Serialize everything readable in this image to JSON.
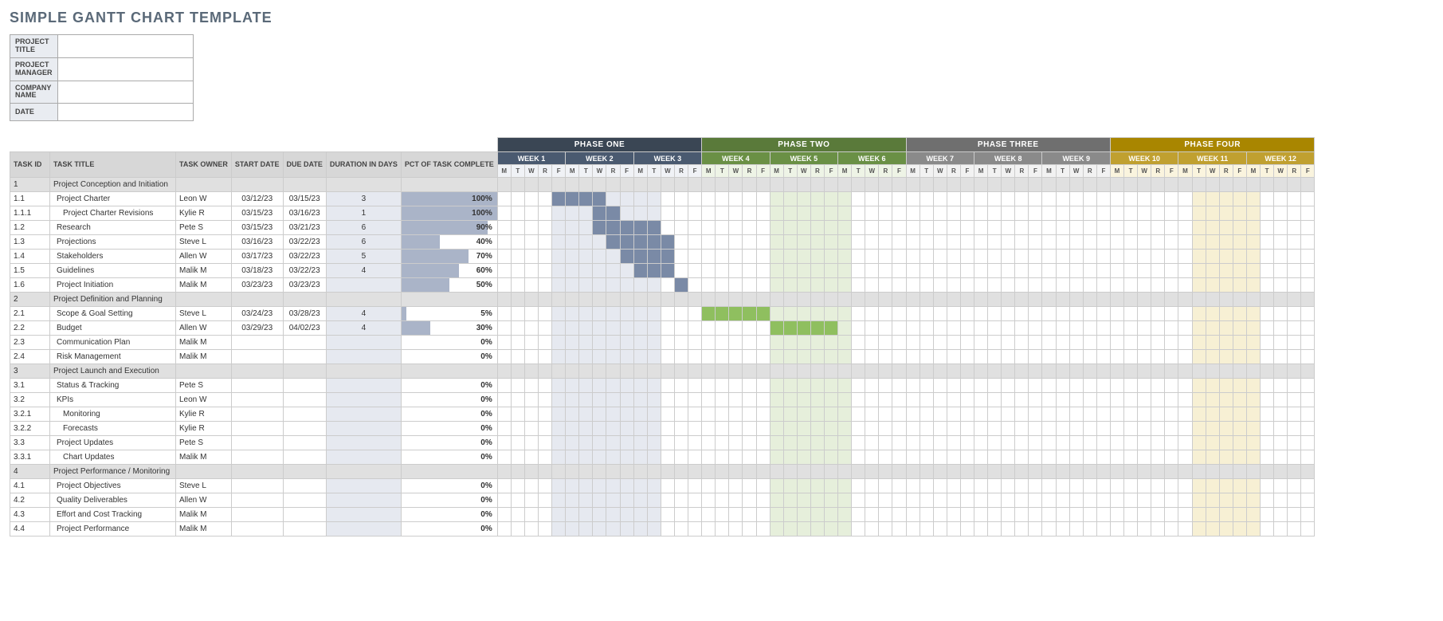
{
  "title": "SIMPLE GANTT CHART TEMPLATE",
  "meta": {
    "project_title_label": "PROJECT TITLE",
    "project_title_value": "",
    "project_manager_label": "PROJECT MANAGER",
    "project_manager_value": "",
    "company_name_label": "COMPANY NAME",
    "company_name_value": "",
    "date_label": "DATE",
    "date_value": ""
  },
  "headers": {
    "task_id": "TASK ID",
    "task_title": "TASK TITLE",
    "task_owner": "TASK OWNER",
    "start_date": "START DATE",
    "due_date": "DUE DATE",
    "duration": "DURATION IN DAYS",
    "pct": "PCT OF TASK COMPLETE"
  },
  "phases": [
    "PHASE ONE",
    "PHASE TWO",
    "PHASE THREE",
    "PHASE FOUR"
  ],
  "weeks": [
    "WEEK 1",
    "WEEK 2",
    "WEEK 3",
    "WEEK 4",
    "WEEK 5",
    "WEEK 6",
    "WEEK 7",
    "WEEK 8",
    "WEEK 9",
    "WEEK 10",
    "WEEK 11",
    "WEEK 12"
  ],
  "days": [
    "M",
    "T",
    "W",
    "R",
    "F"
  ],
  "chart_data": {
    "type": "gantt",
    "shaded_block1": {
      "start": 4,
      "end": 11
    },
    "shaded_block2": {
      "start": 20,
      "end": 25
    },
    "shaded_block4": {
      "start": 51,
      "end": 55
    },
    "rows": [
      {
        "type": "group",
        "id": "1",
        "title": "Project Conception and Initiation"
      },
      {
        "type": "task",
        "id": "1.1",
        "title": "Project Charter",
        "owner": "Leon W",
        "start": "03/12/23",
        "due": "03/15/23",
        "dur": "3",
        "pct": 100,
        "bar": {
          "start": 4,
          "end": 7,
          "color": "p1"
        }
      },
      {
        "type": "task",
        "id": "1.1.1",
        "title": "Project Charter Revisions",
        "owner": "Kylie R",
        "start": "03/15/23",
        "due": "03/16/23",
        "dur": "1",
        "pct": 100,
        "indent": 1,
        "bar": {
          "start": 7,
          "end": 8,
          "color": "p1"
        }
      },
      {
        "type": "task",
        "id": "1.2",
        "title": "Research",
        "owner": "Pete S",
        "start": "03/15/23",
        "due": "03/21/23",
        "dur": "6",
        "pct": 90,
        "bar": {
          "start": 7,
          "end": 11,
          "color": "p1"
        }
      },
      {
        "type": "task",
        "id": "1.3",
        "title": "Projections",
        "owner": "Steve L",
        "start": "03/16/23",
        "due": "03/22/23",
        "dur": "6",
        "pct": 40,
        "bar": {
          "start": 8,
          "end": 12,
          "color": "p1"
        }
      },
      {
        "type": "task",
        "id": "1.4",
        "title": "Stakeholders",
        "owner": "Allen W",
        "start": "03/17/23",
        "due": "03/22/23",
        "dur": "5",
        "pct": 70,
        "bar": {
          "start": 9,
          "end": 12,
          "color": "p1"
        }
      },
      {
        "type": "task",
        "id": "1.5",
        "title": "Guidelines",
        "owner": "Malik M",
        "start": "03/18/23",
        "due": "03/22/23",
        "dur": "4",
        "pct": 60,
        "bar": {
          "start": 10,
          "end": 12,
          "color": "p1"
        }
      },
      {
        "type": "task",
        "id": "1.6",
        "title": "Project Initiation",
        "owner": "Malik M",
        "start": "03/23/23",
        "due": "03/23/23",
        "dur": "",
        "pct": 50,
        "bar": {
          "start": 13,
          "end": 13,
          "color": "p1"
        }
      },
      {
        "type": "group",
        "id": "2",
        "title": "Project Definition and Planning"
      },
      {
        "type": "task",
        "id": "2.1",
        "title": "Scope & Goal Setting",
        "owner": "Steve L",
        "start": "03/24/23",
        "due": "03/28/23",
        "dur": "4",
        "pct": 5,
        "bar": {
          "start": 15,
          "end": 19,
          "color": "p2"
        }
      },
      {
        "type": "task",
        "id": "2.2",
        "title": "Budget",
        "owner": "Allen W",
        "start": "03/29/23",
        "due": "04/02/23",
        "dur": "4",
        "pct": 30,
        "bar": {
          "start": 20,
          "end": 24,
          "color": "p2"
        }
      },
      {
        "type": "task",
        "id": "2.3",
        "title": "Communication Plan",
        "owner": "Malik M",
        "start": "",
        "due": "",
        "dur": "",
        "pct": 0
      },
      {
        "type": "task",
        "id": "2.4",
        "title": "Risk Management",
        "owner": "Malik M",
        "start": "",
        "due": "",
        "dur": "",
        "pct": 0
      },
      {
        "type": "group",
        "id": "3",
        "title": "Project Launch and Execution"
      },
      {
        "type": "task",
        "id": "3.1",
        "title": "Status & Tracking",
        "owner": "Pete S",
        "start": "",
        "due": "",
        "dur": "",
        "pct": 0
      },
      {
        "type": "task",
        "id": "3.2",
        "title": "KPIs",
        "owner": "Leon W",
        "start": "",
        "due": "",
        "dur": "",
        "pct": 0
      },
      {
        "type": "task",
        "id": "3.2.1",
        "title": "Monitoring",
        "owner": "Kylie R",
        "start": "",
        "due": "",
        "dur": "",
        "pct": 0,
        "indent": 1
      },
      {
        "type": "task",
        "id": "3.2.2",
        "title": "Forecasts",
        "owner": "Kylie R",
        "start": "",
        "due": "",
        "dur": "",
        "pct": 0,
        "indent": 1
      },
      {
        "type": "task",
        "id": "3.3",
        "title": "Project Updates",
        "owner": "Pete S",
        "start": "",
        "due": "",
        "dur": "",
        "pct": 0
      },
      {
        "type": "task",
        "id": "3.3.1",
        "title": "Chart Updates",
        "owner": "Malik M",
        "start": "",
        "due": "",
        "dur": "",
        "pct": 0,
        "indent": 1
      },
      {
        "type": "group",
        "id": "4",
        "title": "Project Performance / Monitoring"
      },
      {
        "type": "task",
        "id": "4.1",
        "title": "Project Objectives",
        "owner": "Steve L",
        "start": "",
        "due": "",
        "dur": "",
        "pct": 0
      },
      {
        "type": "task",
        "id": "4.2",
        "title": "Quality Deliverables",
        "owner": "Allen W",
        "start": "",
        "due": "",
        "dur": "",
        "pct": 0
      },
      {
        "type": "task",
        "id": "4.3",
        "title": "Effort and Cost Tracking",
        "owner": "Malik M",
        "start": "",
        "due": "",
        "dur": "",
        "pct": 0
      },
      {
        "type": "task",
        "id": "4.4",
        "title": "Project Performance",
        "owner": "Malik M",
        "start": "",
        "due": "",
        "dur": "",
        "pct": 0
      }
    ]
  }
}
